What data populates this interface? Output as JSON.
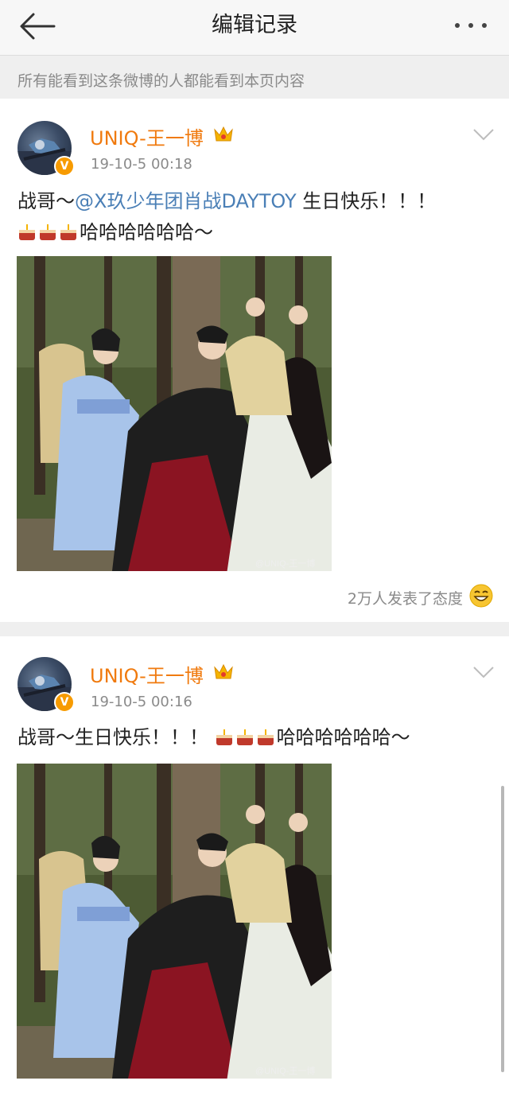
{
  "header": {
    "title": "编辑记录",
    "back_icon": "arrow-left-icon",
    "more_icon": "more-dots-icon"
  },
  "notice": "所有能看到这条微博的人都能看到本页内容",
  "colors": {
    "username": "#f07a0e",
    "mention": "#4a7fb6",
    "secondary_text": "#8a8a8a",
    "background": "#efefef"
  },
  "posts": [
    {
      "username": "UNIQ-王一博",
      "verified_badge": "V",
      "timestamp": "19-10-5 00:18",
      "text_prefix": "战哥～",
      "mention": "@X玖少年团肖战DAYTOY",
      "text_suffix": " 生日快乐！！！",
      "line2_text": "哈哈哈哈哈哈～",
      "image_watermark": "@UNIQ-王一博",
      "reactions": "2万人发表了态度"
    },
    {
      "username": "UNIQ-王一博",
      "verified_badge": "V",
      "timestamp": "19-10-5 00:16",
      "text_prefix": "战哥～生日快乐！！！",
      "text_suffix": "哈哈哈哈哈哈～",
      "image_watermark": "@UNIQ-王一博"
    }
  ]
}
